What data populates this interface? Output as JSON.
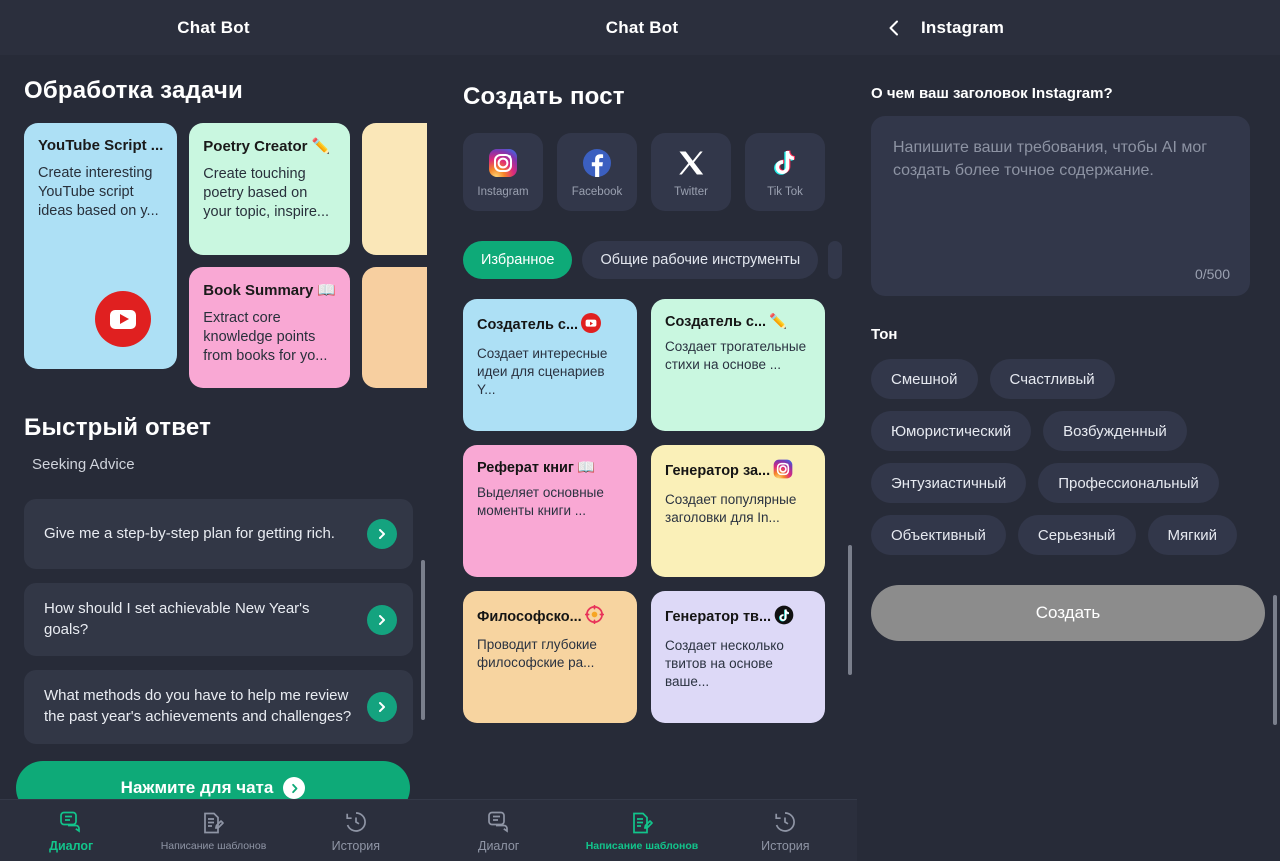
{
  "panel1": {
    "header_title": "Chat Bot",
    "section_task": "Обработка задачи",
    "cards": [
      {
        "title": "YouTube Script ...",
        "desc": "Create interesting YouTube script ideas based on y...",
        "color": "#ade0f5",
        "icon": "youtube-icon"
      },
      {
        "title": "Poetry Creator",
        "desc": "Create touching poetry based on your topic, inspire...",
        "color": "#c9f7e0",
        "icon": "pencil-icon"
      },
      {
        "title": "Book Summary",
        "desc": "Extract core knowledge points from books for yo...",
        "color": "#f9a8d4",
        "icon": "open-book-icon"
      }
    ],
    "section_quick": "Быстрый ответ",
    "quick_category": "Seeking Advice",
    "quick_items": [
      {
        "text": "Give me a step-by-step plan for getting rich."
      },
      {
        "text": "How should I set achievable New Year's goals?"
      },
      {
        "text": "What methods do you have to help me review the past year's achievements and challenges?"
      }
    ],
    "cta_label": "Нажмите для чата",
    "nav": [
      {
        "label": "Диалог",
        "icon": "chat-bubble-icon",
        "active": true
      },
      {
        "label": "Написание шаблонов",
        "icon": "template-write-icon",
        "active": false
      },
      {
        "label": "История",
        "icon": "history-clock-icon",
        "active": false
      }
    ]
  },
  "panel2": {
    "header_title": "Chat Bot",
    "section_title": "Создать пост",
    "socials": [
      {
        "label": "Instagram",
        "icon": "instagram-icon"
      },
      {
        "label": "Facebook",
        "icon": "facebook-icon"
      },
      {
        "label": "Twitter",
        "icon": "twitter-x-icon"
      },
      {
        "label": "Tik Tok",
        "icon": "tiktok-icon"
      }
    ],
    "chips": [
      {
        "label": "Избранное",
        "selected": true
      },
      {
        "label": "Общие рабочие инструменты",
        "selected": false
      }
    ],
    "cards": [
      {
        "title": "Создатель с...",
        "desc": "Создает интересные идеи для сценариев Y...",
        "color": "#ade0f5",
        "icon": "youtube-icon"
      },
      {
        "title": "Создатель с...",
        "desc": "Создает трогательные стихи на основе ...",
        "color": "#c9f7e0",
        "icon": "pencil-icon"
      },
      {
        "title": "Реферат книг",
        "desc": "Выделяет основные моменты книги ...",
        "color": "#f9a8d4",
        "icon": "open-book-icon"
      },
      {
        "title": "Генератор за...",
        "desc": "Создает популярные заголовки для In...",
        "color": "#faf0b8",
        "icon": "instagram-icon"
      },
      {
        "title": "Философско...",
        "desc": "Проводит глубокие философские ра...",
        "color": "#f7d4a0",
        "icon": "compass-icon"
      },
      {
        "title": "Генератор тв...",
        "desc": "Создает несколько твитов на основе ваше...",
        "color": "#ddd9f7",
        "icon": "tiktok-icon"
      }
    ],
    "nav": [
      {
        "label": "Диалог",
        "icon": "chat-bubble-icon",
        "active": false
      },
      {
        "label": "Написание шаблонов",
        "icon": "template-write-icon",
        "active": true
      },
      {
        "label": "История",
        "icon": "history-clock-icon",
        "active": false
      }
    ]
  },
  "panel3": {
    "header_title": "Instagram",
    "back_icon": "chevron-left-icon",
    "prompt_label": "О чем ваш заголовок Instagram?",
    "textarea_placeholder": "Напишите ваши требования, чтобы AI мог создать более точное содержание.",
    "char_counter": "0/500",
    "tone_label": "Тон",
    "tones": [
      "Смешной",
      "Счастливый",
      "Юмористический",
      "Возбужденный",
      "Энтузиастичный",
      "Профессиональный",
      "Объективный",
      "Серьезный",
      "Мягкий"
    ],
    "create_label": "Создать"
  },
  "colors": {
    "bg": "#272b38",
    "surface": "#32374a",
    "topbar": "#2b2f3d",
    "accent": "#0eaa78",
    "accent_text": "#12c48b",
    "disabled_button": "#8c8c8c"
  }
}
